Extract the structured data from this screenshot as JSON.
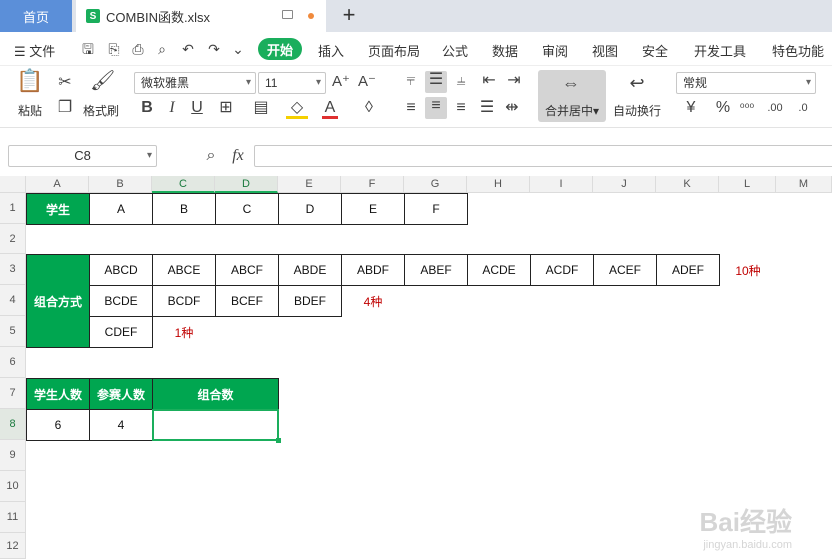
{
  "tabs": {
    "home": "首页",
    "file": "COMBIN函数.xlsx",
    "file_icon": "S"
  },
  "menu": {
    "file": "文件",
    "items": [
      "开始",
      "插入",
      "页面布局",
      "公式",
      "数据",
      "审阅",
      "视图",
      "安全",
      "开发工具",
      "特色功能"
    ]
  },
  "ribbon": {
    "paste": "粘贴",
    "format_painter": "格式刷",
    "font_name": "微软雅黑",
    "font_size": "11",
    "merge_center": "合并居中",
    "wrap_text": "自动换行",
    "number_format": "常规"
  },
  "formula_bar": {
    "name_box": "C8",
    "fx": "fx",
    "value": ""
  },
  "columns": [
    "A",
    "B",
    "C",
    "D",
    "E",
    "F",
    "G",
    "H",
    "I",
    "J",
    "K",
    "L",
    "M"
  ],
  "rows": [
    "1",
    "2",
    "3",
    "4",
    "5",
    "6",
    "7",
    "8",
    "9",
    "10",
    "11",
    "12"
  ],
  "sheet": {
    "row1": {
      "header": "学生",
      "students": [
        "A",
        "B",
        "C",
        "D",
        "E",
        "F"
      ]
    },
    "combo_label": "组合方式",
    "row3": [
      "ABCD",
      "ABCE",
      "ABCF",
      "ABDE",
      "ABDF",
      "ABEF",
      "ACDE",
      "ACDF",
      "ACEF",
      "ADEF"
    ],
    "row3_note": "10种",
    "row4": [
      "BCDE",
      "BCDF",
      "BCEF",
      "BDEF"
    ],
    "row4_note": "4种",
    "row5": [
      "CDEF"
    ],
    "row5_note": "1种",
    "row7": {
      "students_count": "学生人数",
      "participants": "参赛人数",
      "combinations": "组合数"
    },
    "row8": {
      "students_count": "6",
      "participants": "4",
      "combinations": ""
    }
  },
  "watermark": {
    "brand": "Bai经验",
    "url": "jingyan.baidu.com"
  },
  "colors": {
    "accent": "#1aae5c",
    "header_fill": "#00a650",
    "note": "#c00000",
    "home_tab": "#5b8fd9"
  }
}
